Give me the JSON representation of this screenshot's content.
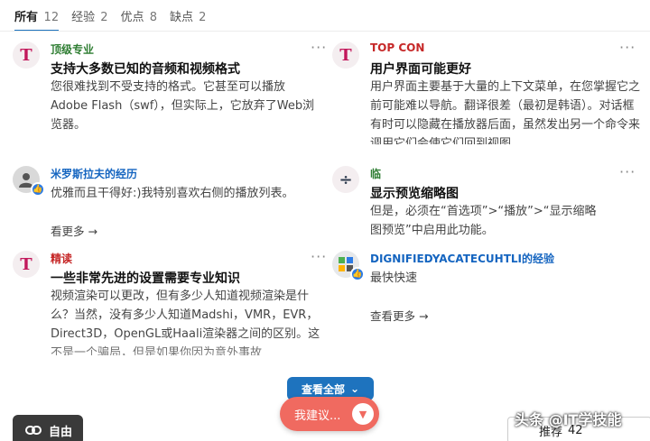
{
  "tabs": [
    {
      "label": "所有",
      "count": "12"
    },
    {
      "label": "经验",
      "count": "2"
    },
    {
      "label": "优点",
      "count": "8"
    },
    {
      "label": "缺点",
      "count": "2"
    }
  ],
  "cards": {
    "c1": {
      "source": "顶级专业",
      "title": "支持大多数已知的音频和视频格式",
      "body": "您很难找到不受支持的格式。它甚至可以播放Adobe Flash（swf），但实际上，它放弃了Web浏览器。"
    },
    "c2": {
      "source": "TOP CON",
      "title": "用户界面可能更好",
      "body": "用户界面主要基于大量的上下文菜单，在您掌握它之前可能难以导航。翻译很差（最初是韩语）。对话框有时可以隐藏在播放器后面，虽然发出另一个命令来调用它们会使它们回到视图"
    },
    "c3": {
      "source": "米罗斯拉夫的经历",
      "body": "优雅而且干得好:)我特别喜欢右侧的播放列表。",
      "see_more": "看更多 →"
    },
    "c4": {
      "source": "临",
      "title": "显示预览缩略图",
      "body": "但是，必须在“首选项”>“播放”>“显示缩略图预览”中启用此功能。"
    },
    "c5": {
      "source": "精读",
      "title": "一些非常先进的设置需要专业知识",
      "body": "视频渲染可以更改，但有多少人知道视频渲染是什么？当然，没有多少人知道Madshi，VMR，EVR，Direct3D，OpenGL或Haali渲染器之间的区别。这不是一个骗局，但是如果你因为意外事故"
    },
    "c6": {
      "source": "DIGNIFIEDYACATECUHTLI的经验",
      "body": "最快快速",
      "see_more": "查看更多 →"
    }
  },
  "buttons": {
    "view_all": "查看全部",
    "suggest": "我建议...",
    "free": "自由",
    "recommend": "推荐",
    "recommend_count": "42"
  },
  "watermark": "头条 @IT学技能",
  "colors": {
    "accent": "#1e73be",
    "suggest": "#f06a60",
    "brand_logo": "#c2185b"
  }
}
